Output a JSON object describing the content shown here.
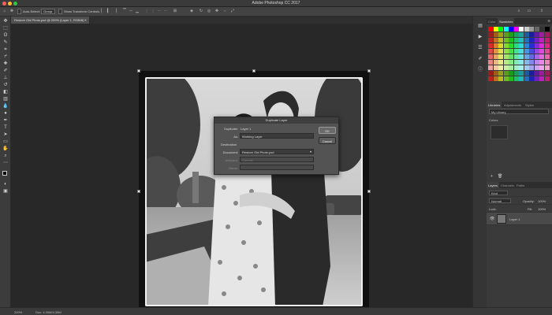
{
  "app": {
    "title": "Adobe Photoshop CC 2017"
  },
  "options_bar": {
    "auto_select_label": "Auto-Select:",
    "auto_select_value": "Group",
    "transform_label": "Show Transform Controls"
  },
  "document": {
    "tab_label": "Restore Old Photo.psd @ 200% (Layer 1, RGB/8)",
    "zoom": "200%",
    "doc_info": "Doc: 4.39M/4.39M"
  },
  "dialog": {
    "title": "Duplicate Layer",
    "duplicate_label": "Duplicate:",
    "duplicate_value": "Layer 1",
    "as_label": "As:",
    "as_value": "Working Layer",
    "destination_label": "Destination",
    "document_label": "Document:",
    "document_value": "Restore Old Photo.psd",
    "artboard_label": "Artboard:",
    "artboard_value": "Canvas",
    "name_label": "Name:",
    "ok_label": "OK",
    "cancel_label": "Cancel"
  },
  "panels": {
    "color_tabs": [
      "Color",
      "Swatches"
    ],
    "lib_tabs": [
      "Libraries",
      "Adjustments",
      "Styles"
    ],
    "library_name": "My Library",
    "library_section": "Colors",
    "layer_tabs": [
      "Layers",
      "Channels",
      "Paths"
    ],
    "kind_label": "Kind",
    "blend_mode": "Normal",
    "opacity_label": "Opacity:",
    "opacity_value": "100%",
    "lock_label": "Lock:",
    "fill_label": "Fill:",
    "fill_value": "100%",
    "layer_name": "Layer 1"
  },
  "swatch_colors": [
    "#ff0000",
    "#ffff00",
    "#00ff00",
    "#00ffff",
    "#0000ff",
    "#ff00ff",
    "#ffffff",
    "#cccccc",
    "#999999",
    "#666666",
    "#333333",
    "#000000"
  ]
}
